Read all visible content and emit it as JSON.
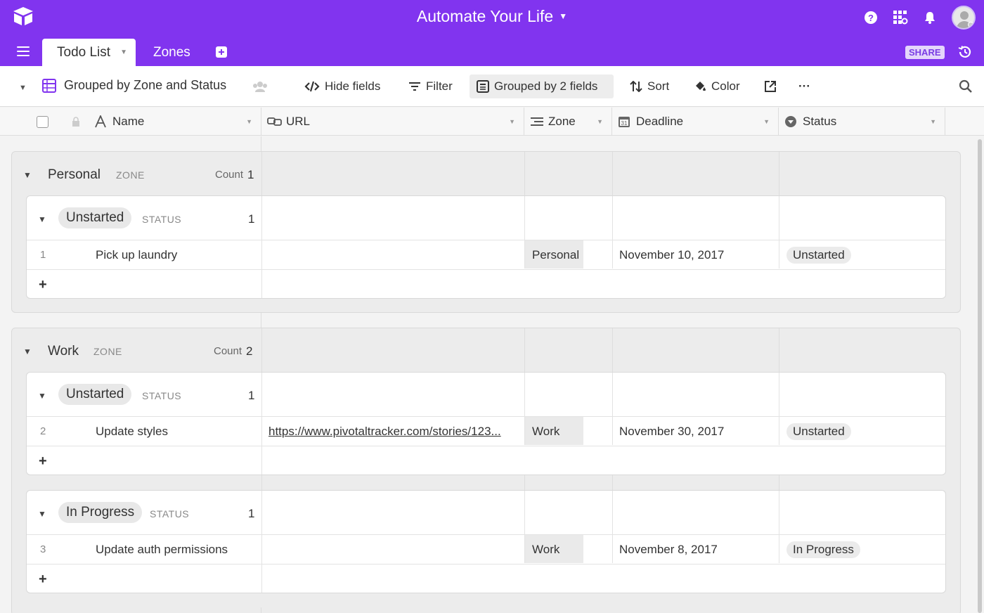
{
  "app": {
    "title": "Automate Your Life"
  },
  "tabs": [
    {
      "label": "Todo List"
    },
    {
      "label": "Zones"
    }
  ],
  "share_label": "SHARE",
  "view": {
    "name": "Grouped by Zone and Status"
  },
  "toolbar": {
    "hide_fields": "Hide fields",
    "filter": "Filter",
    "grouped": "Grouped by 2 fields",
    "sort": "Sort",
    "color": "Color",
    "more": "···"
  },
  "columns": {
    "name": "Name",
    "url": "URL",
    "zone": "Zone",
    "deadline": "Deadline",
    "status": "Status"
  },
  "labels": {
    "zone": "ZONE",
    "status": "STATUS",
    "count": "Count"
  },
  "groups": [
    {
      "zone": "Personal",
      "count": "1",
      "subgroups": [
        {
          "status": "Unstarted",
          "count": "1",
          "rows": [
            {
              "num": "1",
              "name": "Pick up laundry",
              "url": "",
              "zone": "Personal",
              "deadline": "November 10, 2017",
              "status": "Unstarted"
            }
          ]
        }
      ]
    },
    {
      "zone": "Work",
      "count": "2",
      "subgroups": [
        {
          "status": "Unstarted",
          "count": "1",
          "rows": [
            {
              "num": "2",
              "name": "Update styles",
              "url": "https://www.pivotaltracker.com/stories/123...",
              "zone": "Work",
              "deadline": "November 30, 2017",
              "status": "Unstarted"
            }
          ]
        },
        {
          "status": "In Progress",
          "count": "1",
          "rows": [
            {
              "num": "3",
              "name": "Update auth permissions",
              "url": "",
              "zone": "Work",
              "deadline": "November 8, 2017",
              "status": "In Progress"
            }
          ]
        }
      ]
    }
  ],
  "add_row": "+",
  "colors": {
    "topbar": "#8134ef",
    "share_bg": "#e4d6fb"
  }
}
